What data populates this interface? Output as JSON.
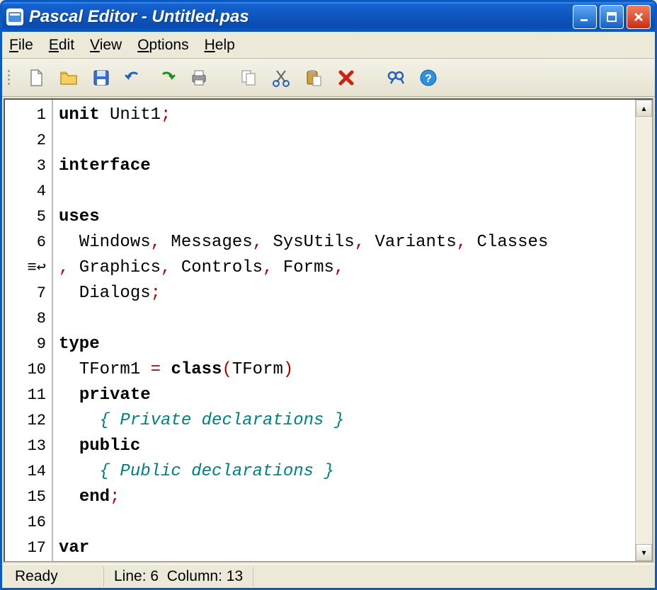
{
  "title": "Pascal Editor - Untitled.pas",
  "menu": {
    "file": "File",
    "edit": "Edit",
    "view": "View",
    "options": "Options",
    "help": "Help"
  },
  "toolbar_icons": {
    "new": "new-file-icon",
    "open": "open-folder-icon",
    "save": "save-disk-icon",
    "undo": "undo-icon",
    "redo": "redo-icon",
    "print": "print-icon",
    "copy": "copy-icon",
    "cut": "cut-icon",
    "paste": "paste-icon",
    "delete": "delete-icon",
    "find": "find-icon",
    "help": "help-icon"
  },
  "gutter": [
    "1",
    "2",
    "3",
    "4",
    "5",
    "6",
    "≡↩",
    "7",
    "8",
    "9",
    "10",
    "11",
    "12",
    "13",
    "14",
    "15",
    "16",
    "17"
  ],
  "code": {
    "lines": [
      {
        "t": [
          {
            "c": "kw",
            "v": "unit"
          },
          {
            "c": "",
            "v": " Unit1"
          },
          {
            "c": "punct",
            "v": ";"
          }
        ]
      },
      {
        "t": []
      },
      {
        "t": [
          {
            "c": "kw",
            "v": "interface"
          }
        ]
      },
      {
        "t": []
      },
      {
        "t": [
          {
            "c": "kw",
            "v": "uses"
          }
        ]
      },
      {
        "t": [
          {
            "c": "",
            "v": "  Windows"
          },
          {
            "c": "punct",
            "v": ","
          },
          {
            "c": "",
            "v": " Messages"
          },
          {
            "c": "punct",
            "v": ","
          },
          {
            "c": "",
            "v": " SysUtils"
          },
          {
            "c": "punct",
            "v": ","
          },
          {
            "c": "",
            "v": " Variants"
          },
          {
            "c": "punct",
            "v": ","
          },
          {
            "c": "",
            "v": " Classes"
          }
        ]
      },
      {
        "t": [
          {
            "c": "punct",
            "v": ","
          },
          {
            "c": "",
            "v": " Graphics"
          },
          {
            "c": "punct",
            "v": ","
          },
          {
            "c": "",
            "v": " Controls"
          },
          {
            "c": "punct",
            "v": ","
          },
          {
            "c": "",
            "v": " Forms"
          },
          {
            "c": "punct",
            "v": ","
          }
        ]
      },
      {
        "t": [
          {
            "c": "",
            "v": "  Dialogs"
          },
          {
            "c": "punct",
            "v": ";"
          }
        ]
      },
      {
        "t": []
      },
      {
        "t": [
          {
            "c": "kw",
            "v": "type"
          }
        ]
      },
      {
        "t": [
          {
            "c": "",
            "v": "  TForm1 "
          },
          {
            "c": "punct",
            "v": "="
          },
          {
            "c": "",
            "v": " "
          },
          {
            "c": "kw",
            "v": "class"
          },
          {
            "c": "punct",
            "v": "("
          },
          {
            "c": "",
            "v": "TForm"
          },
          {
            "c": "punct",
            "v": ")"
          }
        ]
      },
      {
        "t": [
          {
            "c": "",
            "v": "  "
          },
          {
            "c": "kw",
            "v": "private"
          }
        ]
      },
      {
        "t": [
          {
            "c": "",
            "v": "    "
          },
          {
            "c": "comment",
            "v": "{ Private declarations }"
          }
        ]
      },
      {
        "t": [
          {
            "c": "",
            "v": "  "
          },
          {
            "c": "kw",
            "v": "public"
          }
        ]
      },
      {
        "t": [
          {
            "c": "",
            "v": "    "
          },
          {
            "c": "comment",
            "v": "{ Public declarations }"
          }
        ]
      },
      {
        "t": [
          {
            "c": "",
            "v": "  "
          },
          {
            "c": "kw",
            "v": "end"
          },
          {
            "c": "punct",
            "v": ";"
          }
        ]
      },
      {
        "t": []
      },
      {
        "t": [
          {
            "c": "kw",
            "v": "var"
          }
        ]
      }
    ]
  },
  "status": {
    "ready": "Ready",
    "line_label": "Line:",
    "line_value": "6",
    "col_label": "Column:",
    "col_value": "13"
  }
}
